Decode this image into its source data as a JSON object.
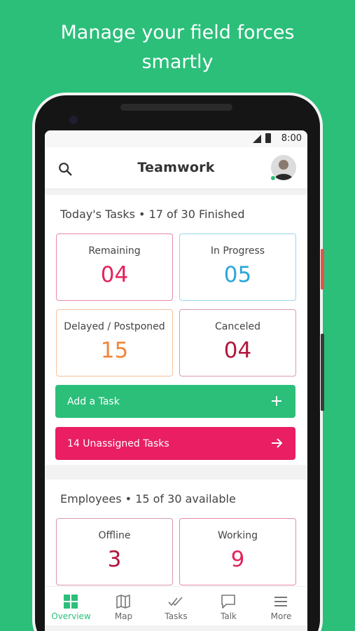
{
  "promo": {
    "line1": "Manage your field forces",
    "line2": "smartly"
  },
  "statusbar": {
    "time": "8:00"
  },
  "appbar": {
    "title": "Teamwork"
  },
  "tasks": {
    "title": "Today's Tasks • 17 of 30 Finished",
    "tiles": [
      {
        "label": "Remaining",
        "value": "04",
        "color": "#e3245c",
        "border": "#e88aa7"
      },
      {
        "label": "In Progress",
        "value": "05",
        "color": "#2aa7d9",
        "border": "#97d6f0"
      },
      {
        "label": "Delayed / Postponed",
        "value": "15",
        "color": "#f0863c",
        "border": "#f6c19a"
      },
      {
        "label": "Canceled",
        "value": "04",
        "color": "#b3163d",
        "border": "#d99aaa"
      }
    ],
    "add_button": "Add a Task",
    "unassigned_button": "14 Unassigned Tasks"
  },
  "employees": {
    "title": "Employees • 15 of 30 available",
    "tiles": [
      {
        "label": "Offline",
        "value": "3",
        "color": "#b3163d",
        "border": "#d99aaa"
      },
      {
        "label": "Working",
        "value": "9",
        "color": "#e3245c",
        "border": "#e88aa7"
      }
    ]
  },
  "nav": {
    "items": [
      {
        "label": "Overview",
        "icon": "grid-icon",
        "active": true
      },
      {
        "label": "Map",
        "icon": "map-icon",
        "active": false
      },
      {
        "label": "Tasks",
        "icon": "double-check-icon",
        "active": false
      },
      {
        "label": "Talk",
        "icon": "chat-icon",
        "active": false
      },
      {
        "label": "More",
        "icon": "menu-icon",
        "active": false
      }
    ]
  },
  "colors": {
    "brand_green": "#2bbf7a",
    "accent_pink": "#e91e63"
  }
}
